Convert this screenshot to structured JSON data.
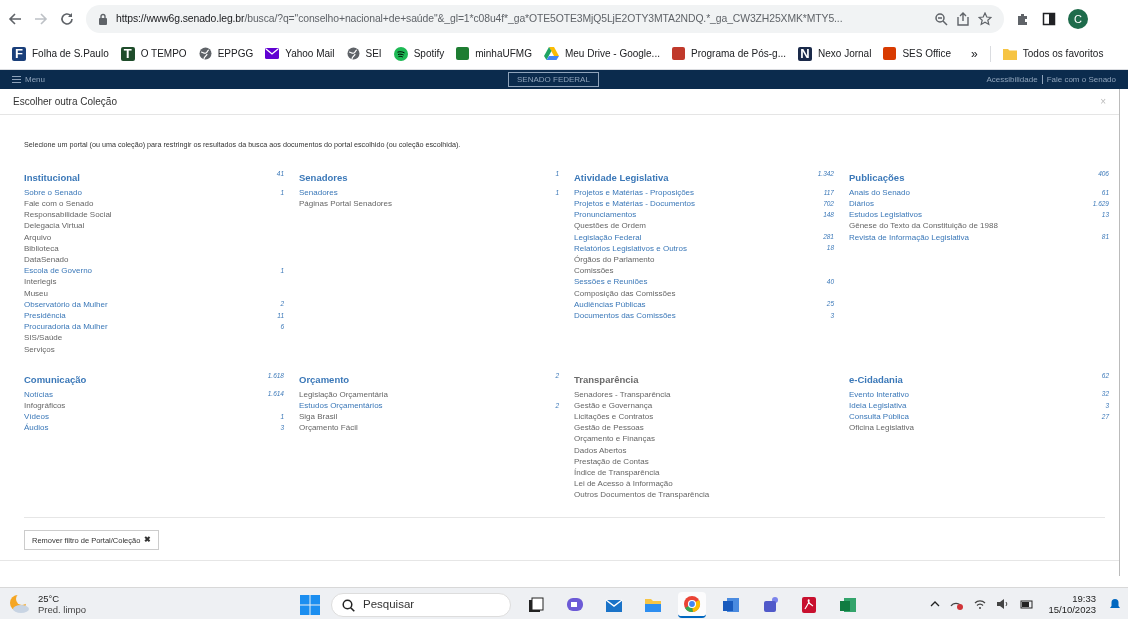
{
  "browser": {
    "url_host": "https://www6g.senado.leg.br",
    "url_rest": "/busca/?q=\"conselho+nacional+de+saúde\"&_gl=1*c08u4f*_ga*OTE5OTE3MjQ5LjE2OTY3MTA2NDQ.*_ga_CW3ZH25XMK*MTY5...",
    "profile": "C"
  },
  "bookmarks": [
    {
      "label": "Folha de S.Paulo",
      "kind": "glyph",
      "glyph": "F",
      "color": "#1a3f7a"
    },
    {
      "label": "O TEMPO",
      "kind": "glyph",
      "glyph": "T",
      "color": "#1f4d2b"
    },
    {
      "label": "EPPGG",
      "kind": "globe",
      "color": "#5f6368"
    },
    {
      "label": "Yahoo Mail",
      "kind": "mail",
      "color": "#6001d2"
    },
    {
      "label": "SEI",
      "kind": "globe",
      "color": "#5f6368"
    },
    {
      "label": "Spotify",
      "kind": "circle",
      "color": "#1db954"
    },
    {
      "label": "minhaUFMG",
      "kind": "square",
      "color": "#1e7d32"
    },
    {
      "label": "Meu Drive - Google...",
      "kind": "drive",
      "color": "#fbbc04"
    },
    {
      "label": "Programa de Pós-g...",
      "kind": "square",
      "color": "#c0392b"
    },
    {
      "label": "Nexo Jornal",
      "kind": "glyph",
      "glyph": "N",
      "color": "#1b2a4a"
    },
    {
      "label": "SES Office",
      "kind": "square",
      "color": "#d83b01"
    }
  ],
  "bookmarks_more": "»",
  "bookmarks_folder": "Todos os favoritos",
  "site_header": {
    "menu": "Menu",
    "brand": "SENADO FEDERAL",
    "links": [
      "Acessibilidade",
      "Fale com o Senado"
    ]
  },
  "modal": {
    "title": "Escolher outra Coleção",
    "close": "×",
    "intro": "Selecione um portal (ou uma coleção) para restringir os resultados da busca aos documentos do portal escolhido (ou coleção escolhida).",
    "groups": [
      {
        "title": "Institucional",
        "count": "41",
        "link": true,
        "items": [
          {
            "label": "Sobre o Senado",
            "count": "1",
            "link": true
          },
          {
            "label": "Fale com o Senado",
            "link": false
          },
          {
            "label": "Responsabilidade Social",
            "link": false
          },
          {
            "label": "Delegacia Virtual",
            "link": false
          },
          {
            "label": "Arquivo",
            "link": false
          },
          {
            "label": "Biblioteca",
            "link": false
          },
          {
            "label": "DataSenado",
            "link": false
          },
          {
            "label": "Escola de Governo",
            "count": "1",
            "link": true
          },
          {
            "label": "Interlegis",
            "link": false
          },
          {
            "label": "Museu",
            "link": false
          },
          {
            "label": "Observatório da Mulher",
            "count": "2",
            "link": true
          },
          {
            "label": "Presidência",
            "count": "11",
            "link": true
          },
          {
            "label": "Procuradoria da Mulher",
            "count": "6",
            "link": true
          },
          {
            "label": "SIS/Saúde",
            "link": false
          },
          {
            "label": "Serviços",
            "link": false
          }
        ]
      },
      {
        "title": "Senadores",
        "count": "1",
        "link": true,
        "items": [
          {
            "label": "Senadores",
            "count": "1",
            "link": true
          },
          {
            "label": "Páginas Portal Senadores",
            "link": false
          }
        ]
      },
      {
        "title": "Atividade Legislativa",
        "count": "1.342",
        "link": true,
        "items": [
          {
            "label": "Projetos e Matérias - Proposições",
            "count": "117",
            "link": true
          },
          {
            "label": "Projetos e Matérias - Documentos",
            "count": "702",
            "link": true
          },
          {
            "label": "Pronunciamentos",
            "count": "148",
            "link": true
          },
          {
            "label": "Questões de Ordem",
            "link": false
          },
          {
            "label": "Legislação Federal",
            "count": "281",
            "link": true
          },
          {
            "label": "Relatórios Legislativos e Outros",
            "count": "18",
            "link": true
          },
          {
            "label": "Órgãos do Parlamento",
            "link": false
          },
          {
            "label": "Comissões",
            "link": false
          },
          {
            "label": "Sessões e Reuniões",
            "count": "40",
            "link": true
          },
          {
            "label": "Composição das Comissões",
            "link": false
          },
          {
            "label": "Audiências Públicas",
            "count": "25",
            "link": true
          },
          {
            "label": "Documentos das Comissões",
            "count": "3",
            "link": true
          }
        ]
      },
      {
        "title": "Publicações",
        "count": "406",
        "link": true,
        "items": [
          {
            "label": "Anais do Senado",
            "count": "61",
            "link": true
          },
          {
            "label": "Diários",
            "count": "1.629",
            "link": true
          },
          {
            "label": "Estudos Legislativos",
            "count": "13",
            "link": true
          },
          {
            "label": "Gênese do Texto da Constituição de 1988",
            "link": false
          },
          {
            "label": "Revista de Informação Legislativa",
            "count": "81",
            "link": true
          }
        ]
      },
      {
        "title": "Comunicação",
        "count": "1.618",
        "link": true,
        "items": [
          {
            "label": "Notícias",
            "count": "1.614",
            "link": true
          },
          {
            "label": "Infográficos",
            "link": false
          },
          {
            "label": "Vídeos",
            "count": "1",
            "link": true
          },
          {
            "label": "Áudios",
            "count": "3",
            "link": true
          }
        ]
      },
      {
        "title": "Orçamento",
        "count": "2",
        "link": true,
        "items": [
          {
            "label": "Legislação Orçamentária",
            "link": false
          },
          {
            "label": "Estudos Orçamentários",
            "count": "2",
            "link": true
          },
          {
            "label": "Siga Brasil",
            "link": false
          },
          {
            "label": "Orçamento Fácil",
            "link": false
          }
        ]
      },
      {
        "title": "Transparência",
        "link": false,
        "items": [
          {
            "label": "Senadores - Transparência",
            "link": false
          },
          {
            "label": "Gestão e Governança",
            "link": false
          },
          {
            "label": "Licitações e Contratos",
            "link": false
          },
          {
            "label": "Gestão de Pessoas",
            "link": false
          },
          {
            "label": "Orçamento e Finanças",
            "link": false
          },
          {
            "label": "Dados Abertos",
            "link": false
          },
          {
            "label": "Prestação de Contas",
            "link": false
          },
          {
            "label": "Índice de Transparência",
            "link": false
          },
          {
            "label": "Lei de Acesso à Informação",
            "link": false
          },
          {
            "label": "Outros Documentos de Transparência",
            "link": false
          }
        ]
      },
      {
        "title": "e-Cidadania",
        "count": "62",
        "link": true,
        "items": [
          {
            "label": "Evento Interativo",
            "count": "32",
            "link": true
          },
          {
            "label": "Ideia Legislativa",
            "count": "3",
            "link": true
          },
          {
            "label": "Consulta Pública",
            "count": "27",
            "link": true
          },
          {
            "label": "Oficina Legislativa",
            "link": false
          }
        ]
      }
    ],
    "remove_button": "Remover filtro de Portal/Coleção",
    "remove_icon": "✖"
  },
  "taskbar": {
    "temperature": "25°C",
    "weather": "Pred. limpo",
    "search": "Pesquisar",
    "apps": [
      {
        "kind": "tiles",
        "active": false
      },
      {
        "kind": "chat",
        "active": false
      },
      {
        "kind": "mail",
        "active": false
      },
      {
        "kind": "folder",
        "active": false
      },
      {
        "kind": "chrome",
        "active": true
      },
      {
        "kind": "word",
        "active": false
      },
      {
        "kind": "teams",
        "active": false
      },
      {
        "kind": "pdf",
        "active": false
      },
      {
        "kind": "excel",
        "active": false
      }
    ],
    "time": "19:33",
    "date": "15/10/2023"
  }
}
